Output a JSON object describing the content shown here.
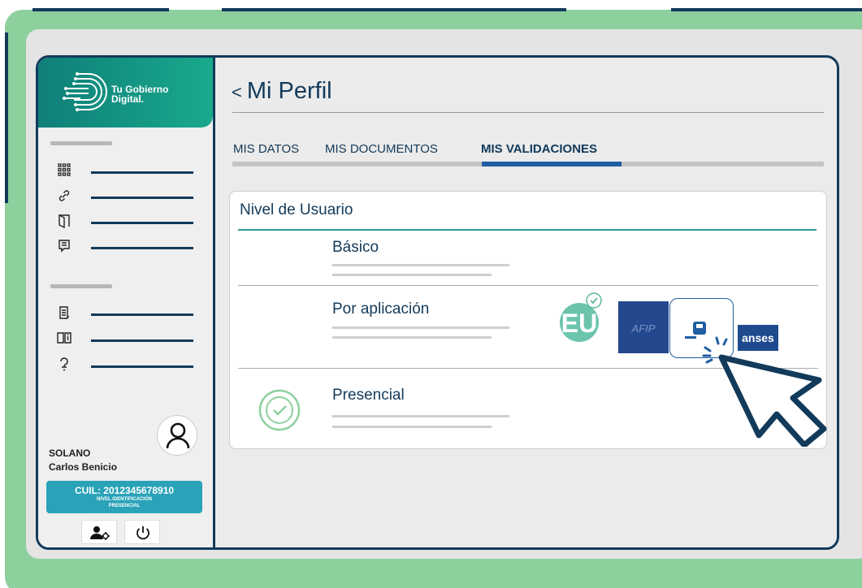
{
  "brand": {
    "name_line1": "Tu Gobierno",
    "name_line2": "Digital."
  },
  "sidebar": {
    "menu_icons": [
      "grid-icon",
      "link-icon",
      "door-icon",
      "chat-icon",
      "document-icon",
      "book-info-icon",
      "help-icon"
    ]
  },
  "user": {
    "surname": "SOLANO",
    "name": "Carlos Benicio",
    "cuil": "CUIL: 2012345678910",
    "level_line1": "NIVEL IDENTIFICACIÓN",
    "level_line2": "PRESENCIAL"
  },
  "page": {
    "back": "<",
    "title": "Mi Perfil"
  },
  "tabs": [
    {
      "label": "MIS DATOS",
      "active": false
    },
    {
      "label": "MIS DOCUMENTOS",
      "active": false
    },
    {
      "label": "MIS VALIDACIONES",
      "active": true
    }
  ],
  "card": {
    "title": "Nivel de Usuario",
    "levels": [
      {
        "label": "Básico"
      },
      {
        "label": "Por aplicación",
        "apps": [
          "Mi Argentina",
          "AFIP",
          "Mi BA",
          "anses"
        ]
      },
      {
        "label": "Presencial",
        "validated": true
      }
    ],
    "anses_text": "anses"
  },
  "colors": {
    "navy": "#123a5a",
    "teal": "#2e9a97",
    "green_frame": "#8ecf9e",
    "tab_active": "#1f5ea2"
  }
}
